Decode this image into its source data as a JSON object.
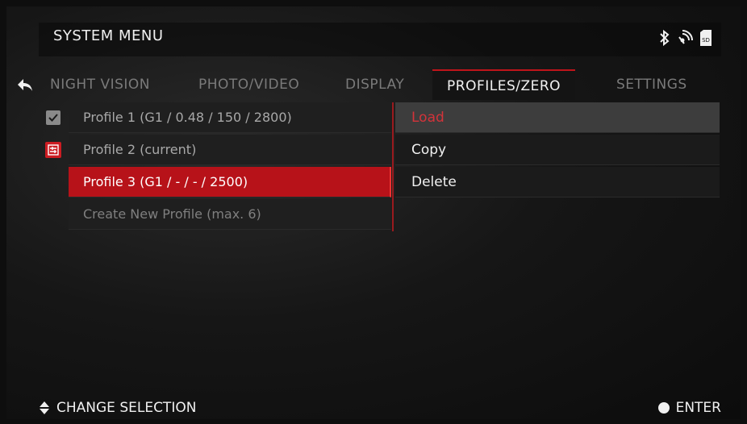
{
  "header": {
    "title": "SYSTEM MENU",
    "status_icons": [
      "bluetooth-icon",
      "wifi-icon",
      "sd-card-icon"
    ],
    "sd_label": "SD"
  },
  "tabs": [
    {
      "label": "NIGHT VISION",
      "active": false
    },
    {
      "label": "PHOTO/VIDEO",
      "active": false
    },
    {
      "label": "DISPLAY",
      "active": false
    },
    {
      "label": "PROFILES/ZERO",
      "active": true
    },
    {
      "label": "SETTINGS",
      "active": false
    }
  ],
  "profiles": [
    {
      "label": "Profile 1 (G1 / 0.48 / 150 / 2800)",
      "marker": "checkbox-icon"
    },
    {
      "label": "Profile 2 (current)",
      "marker": "current-profile-icon"
    },
    {
      "label": "Profile 3  (G1 / - / - / 2500)",
      "marker": "",
      "selected": true
    },
    {
      "label": "Create New Profile (max. 6)",
      "marker": ""
    }
  ],
  "actions": [
    {
      "label": "Load",
      "highlight": true
    },
    {
      "label": "Copy",
      "highlight": false
    },
    {
      "label": "Delete",
      "highlight": false
    }
  ],
  "footer": {
    "change_selection": "CHANGE SELECTION",
    "enter": "ENTER"
  },
  "colors": {
    "accent": "#c0141a",
    "selected_row": "#b71219",
    "highlight_text": "#d3333a"
  }
}
